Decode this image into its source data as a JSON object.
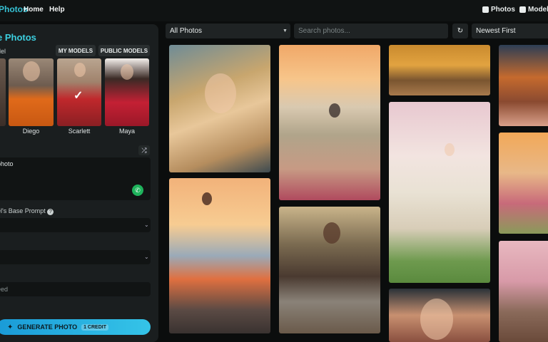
{
  "header": {
    "brand": "Photos",
    "nav": [
      "Home",
      "Help"
    ],
    "right_nav": [
      {
        "label": "Photos",
        "icon": "wand-icon"
      },
      {
        "label": "Models",
        "icon": "models-icon"
      }
    ]
  },
  "sidebar": {
    "title": "e Photos",
    "model_label": "del",
    "tabs": [
      "MY MODELS",
      "PUBLIC MODELS"
    ],
    "models": [
      {
        "name": "Diego",
        "selected": false
      },
      {
        "name": "Scarlett",
        "selected": true
      },
      {
        "name": "Maya",
        "selected": false
      }
    ],
    "prompt_text": "photo",
    "base_prompt_label": "el's Base Prompt",
    "seed_placeholder": "eed",
    "generate_label": "GENERATE PHOTO",
    "credit_label": "1 CREDIT"
  },
  "gallery": {
    "filter_all": "All Photos",
    "search_placeholder": "Search photos...",
    "sort": "Newest First"
  },
  "colors": {
    "accent": "#36c3d6",
    "panel": "#1a1e1f",
    "background": "#0b0d0d"
  }
}
